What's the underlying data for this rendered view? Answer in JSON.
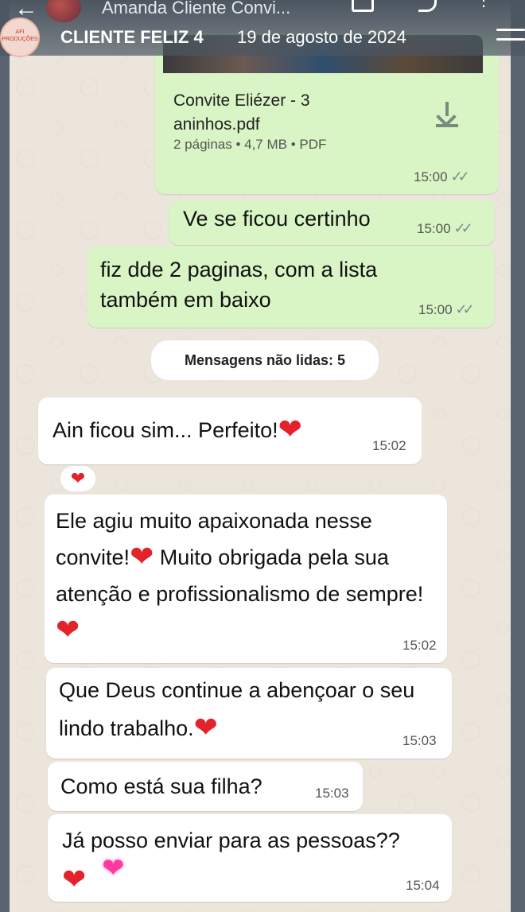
{
  "header": {
    "contact_name": "Amanda Cliente Convi...",
    "story_title": "CLIENTE FELIZ 4",
    "story_date": "19 de agosto de 2024",
    "logo_text": "AFI PRODUÇÕES"
  },
  "document": {
    "name": "Convite Eliézer - 3 aninhos.pdf",
    "meta": "2 páginas • 4,7 MB • PDF",
    "time": "15:00"
  },
  "outgoing": [
    {
      "text": "Ve se ficou certinho",
      "time": "15:00"
    },
    {
      "text": "fiz dde 2 paginas, com a lista também em baixo",
      "time": "15:00"
    }
  ],
  "unread_label": "Mensagens não lidas: 5",
  "incoming": [
    {
      "text": "Ain ficou sim... Perfeito!",
      "time": "15:02"
    },
    {
      "text_a": "Ele agiu muito apaixonada nesse convite!",
      "text_b": " Muito obrigada pela sua atenção e profissionalismo de sempre!",
      "time": "15:02"
    },
    {
      "text": "Que Deus continue a abençoar o seu lindo trabalho.",
      "time": "15:03"
    },
    {
      "text": "Como está sua filha?",
      "time": "15:03"
    },
    {
      "text": "Já posso enviar para as pessoas??",
      "time": "15:04"
    }
  ],
  "icons": {
    "heart": "❤",
    "ticks": "✓✓",
    "back": "←",
    "more": "⋮"
  },
  "colors": {
    "outgoing_bubble": "#d9f5c5",
    "incoming_bubble": "#ffffff",
    "heart": "#e3232c",
    "chat_bg": "#ece5dc"
  }
}
